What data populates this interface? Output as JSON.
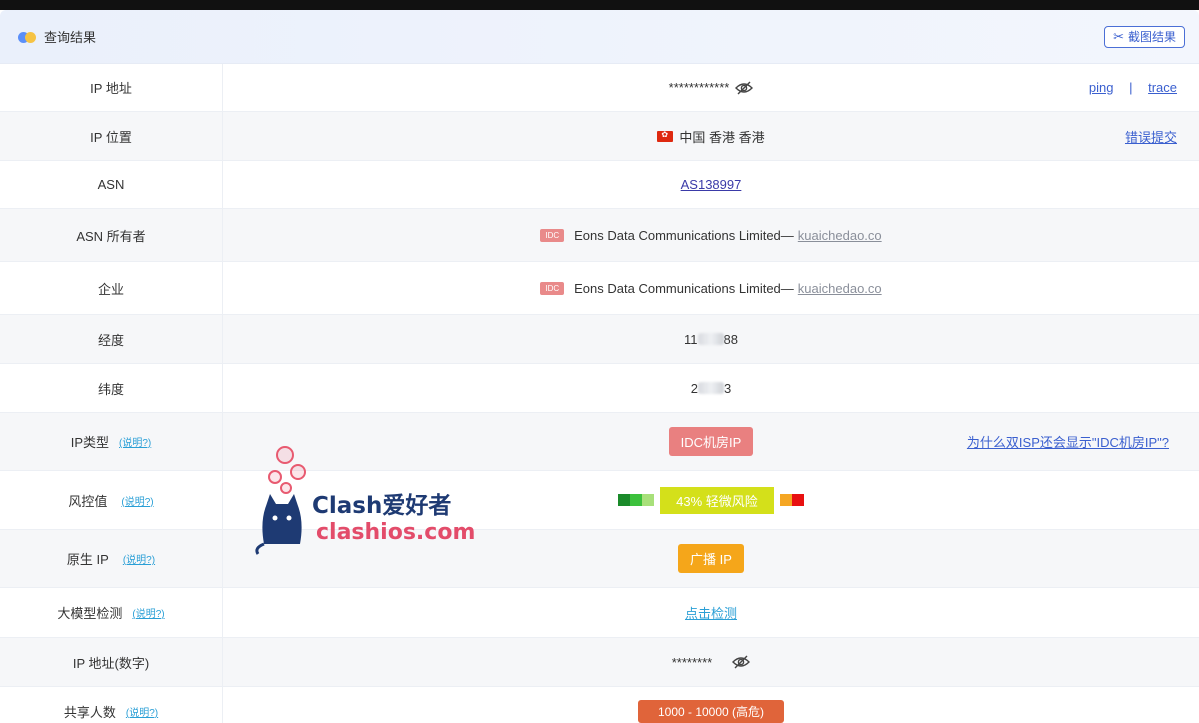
{
  "header": {
    "title": "查询结果",
    "screenshot_button": "截图结果"
  },
  "rows": {
    "ip": {
      "label": "IP 地址",
      "value": "************",
      "link_ping": "ping",
      "separator": "|",
      "link_trace": "trace"
    },
    "location": {
      "label": "IP 位置",
      "value": "中国 香港 香港",
      "link": "错误提交"
    },
    "asn": {
      "label": "ASN",
      "value": "AS138997"
    },
    "asn_owner": {
      "label": "ASN 所有者",
      "tag": "IDC",
      "value": "Eons Data Communications Limited—",
      "domain": "kuaichedao.co"
    },
    "company": {
      "label": "企业",
      "tag": "IDC",
      "value": "Eons Data Communications Limited—",
      "domain": "kuaichedao.co"
    },
    "longitude": {
      "label": "经度",
      "value_start": "11",
      "value_end": "88"
    },
    "latitude": {
      "label": "纬度",
      "value_start": "2",
      "value_end": "3"
    },
    "ip_type": {
      "label": "IP类型",
      "help": "(说明?)",
      "badge": "IDC机房IP",
      "link": "为什么双ISP还会显示\"IDC机房IP\"?"
    },
    "risk": {
      "label": "风控值",
      "help": "(说明?)",
      "value": "43%  轻微风险"
    },
    "native_ip": {
      "label": "原生 IP",
      "help": "(说明?)",
      "badge": "广播 IP"
    },
    "llm_check": {
      "label": "大模型检测",
      "help": "(说明?)",
      "link": "点击检测"
    },
    "ip_numeric": {
      "label": "IP 地址(数字)",
      "value": "********"
    },
    "shared_users": {
      "label": "共享人数",
      "help": "(说明?)",
      "badge": "1000 - 10000 (高危)"
    }
  },
  "watermark": {
    "line1": "Clash爱好者",
    "line2": "clashios.com"
  },
  "colors": {
    "accent": "#3a5fcf",
    "idc": "#e98080",
    "broadcast": "#f5a61a",
    "risk": "#d4e01a",
    "shared": "#e0643a"
  },
  "icons": {
    "eye": "eye-slash-icon",
    "scissors": "scissors-icon",
    "flag": "hong-kong-flag-icon"
  }
}
